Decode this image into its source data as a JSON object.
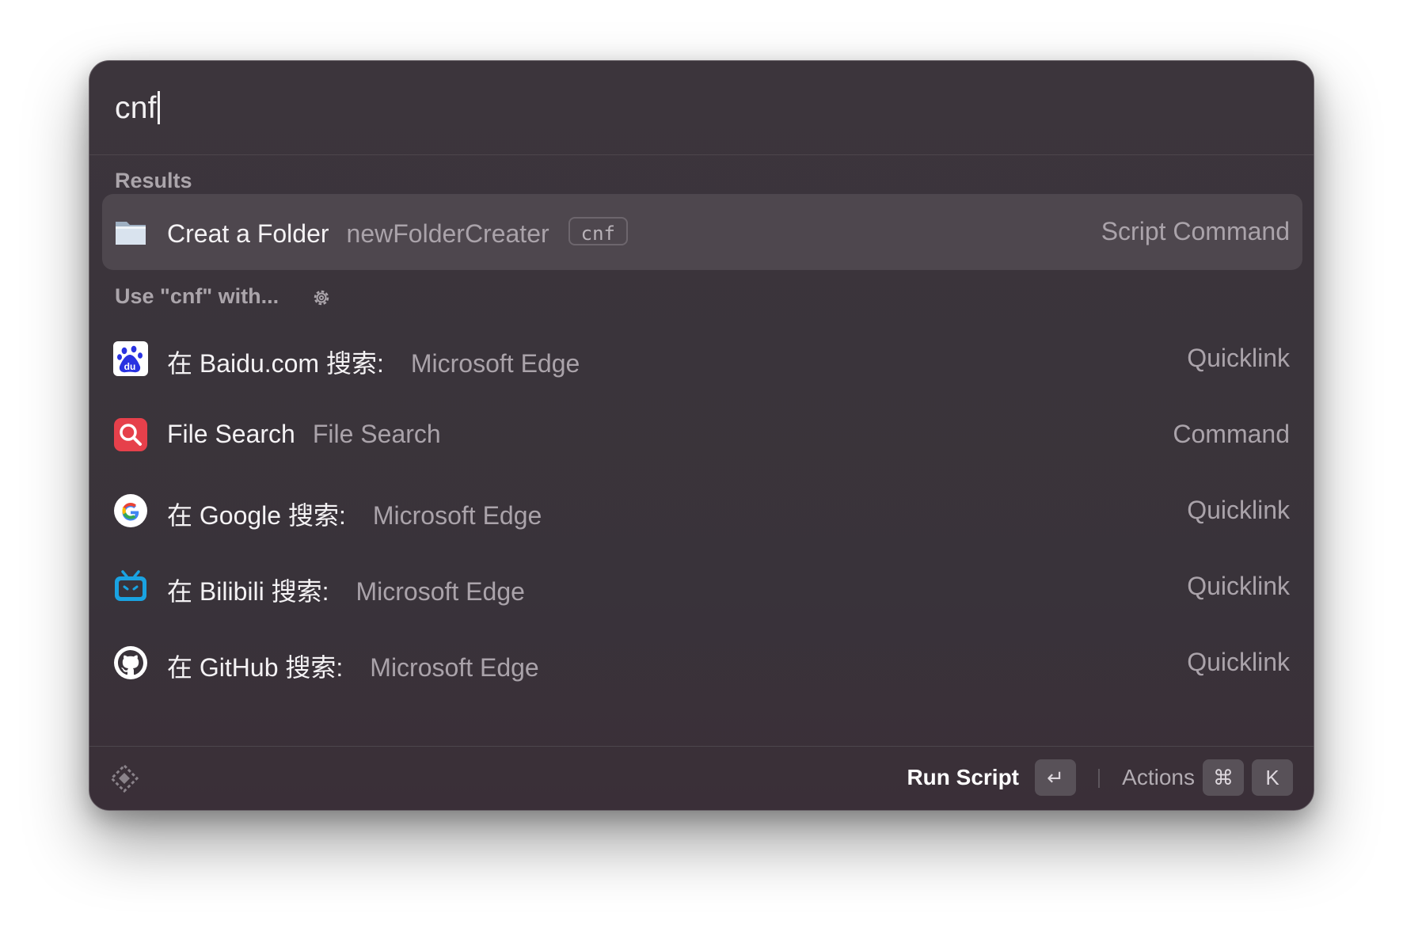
{
  "search": {
    "query": "cnf"
  },
  "sections": {
    "results_label": "Results",
    "use_label": "Use \"cnf\" with..."
  },
  "results": [
    {
      "title": "Creat a Folder",
      "subtitle": "newFolderCreater",
      "alias": "cnf",
      "kind": "Script Command",
      "icon": "folder-icon"
    }
  ],
  "fallbacks": [
    {
      "title": "在 Baidu.com 搜索:",
      "subtitle": "Microsoft Edge",
      "kind": "Quicklink",
      "icon": "baidu-icon"
    },
    {
      "title": "File Search",
      "subtitle": "File Search",
      "kind": "Command",
      "icon": "file-search-icon"
    },
    {
      "title": "在 Google 搜索:",
      "subtitle": "Microsoft Edge",
      "kind": "Quicklink",
      "icon": "google-icon"
    },
    {
      "title": "在 Bilibili 搜索:",
      "subtitle": "Microsoft Edge",
      "kind": "Quicklink",
      "icon": "bilibili-icon"
    },
    {
      "title": "在 GitHub 搜索:",
      "subtitle": "Microsoft Edge",
      "kind": "Quicklink",
      "icon": "github-icon"
    }
  ],
  "footer": {
    "primary_action": "Run Script",
    "enter_key": "↵",
    "actions_label": "Actions",
    "cmd_key": "⌘",
    "k_key": "K"
  },
  "colors": {
    "window_bg": "#3c353c",
    "selected_row": "#4e474e",
    "text_primary": "#f4f2f4",
    "text_secondary": "#aaa3aa"
  }
}
